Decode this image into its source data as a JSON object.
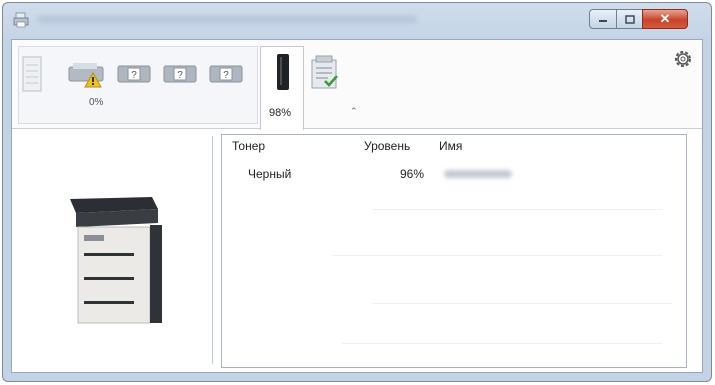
{
  "window": {
    "icon": "printer-app-icon",
    "buttons": {
      "minimize": "minimize-icon",
      "maximize": "maximize-icon",
      "close": "✕"
    }
  },
  "toolbar": {
    "status_percent": "0%",
    "toner_percent": "98%",
    "expand_glyph": "⌃",
    "settings_icon": "gear-icon"
  },
  "toner_table": {
    "columns": {
      "toner": "Тонер",
      "level": "Уровень",
      "name": "Имя"
    },
    "rows": [
      {
        "toner": "Черный",
        "level": "96%",
        "name": ""
      }
    ]
  },
  "colors": {
    "title_gradient": "#c3d3e6",
    "close_button": "#c8432b",
    "border": "#9aa7b8"
  }
}
